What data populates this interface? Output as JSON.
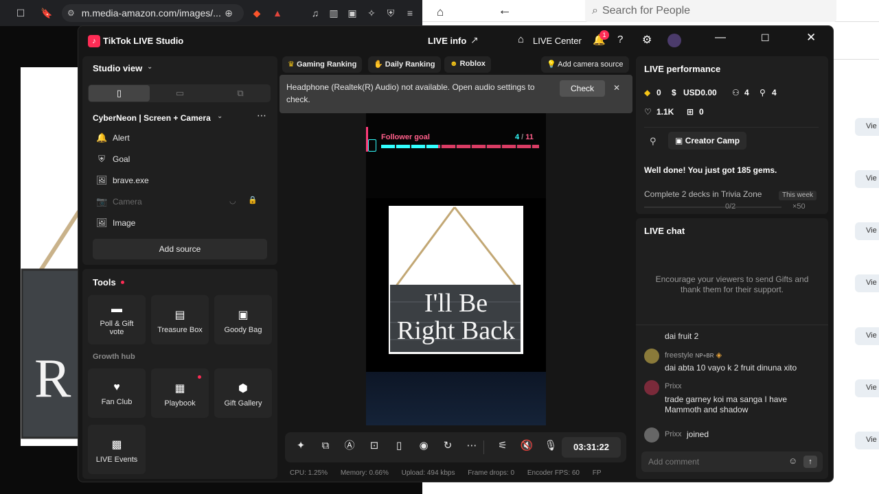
{
  "browser": {
    "url": "m.media-amazon.com/images/..."
  },
  "right_page": {
    "search_placeholder": "Search for People",
    "view_label": "Vie"
  },
  "app": {
    "title": "TikTok LIVE Studio",
    "live_info": "LIVE info",
    "live_center": "LIVE Center",
    "notification_count": "1"
  },
  "studio_view": {
    "title": "Studio view",
    "scene_name": "CyberNeon | Screen + Camera",
    "sources": [
      {
        "icon": "bell-icon",
        "label": "Alert",
        "disabled": false
      },
      {
        "icon": "shield-icon",
        "label": "Goal",
        "disabled": false
      },
      {
        "icon": "image-icon",
        "label": "brave.exe",
        "disabled": false
      },
      {
        "icon": "camera-icon",
        "label": "Camera",
        "disabled": true
      },
      {
        "icon": "image-icon",
        "label": "Image",
        "disabled": false
      }
    ],
    "add_source": "Add source"
  },
  "tools": {
    "title": "Tools",
    "items": [
      {
        "icon": "poll-icon",
        "label_1": "Poll & Gift",
        "label_2": "vote"
      },
      {
        "icon": "treasure-box-icon",
        "label_1": "Treasure Box",
        "label_2": ""
      },
      {
        "icon": "goody-bag-icon",
        "label_1": "Goody Bag",
        "label_2": ""
      }
    ],
    "growth_hub": "Growth hub",
    "growth_items": [
      {
        "icon": "heart-icon",
        "label": "Fan Club"
      },
      {
        "icon": "playbook-icon",
        "label": "Playbook"
      },
      {
        "icon": "gift-gallery-icon",
        "label": "Gift Gallery"
      },
      {
        "icon": "calendar-icon",
        "label": "LIVE Events"
      }
    ]
  },
  "top_chips": [
    "Gaming Ranking",
    "Daily Ranking",
    "Roblox"
  ],
  "add_camera_source": "Add camera source",
  "notice": {
    "text_1": "Headphone (Realtek(R) Audio) not available. Open audio settings to",
    "text_2": "check.",
    "check": "Check"
  },
  "preview": {
    "goal_label": "Follower goal",
    "goal_current": "4",
    "goal_sep": " / ",
    "goal_total": "11",
    "goal_progress": 0.36,
    "sign_line_1": "I'll Be",
    "sign_line_2": "Right Back"
  },
  "timer": "03:31:22",
  "status_bar": {
    "cpu": "CPU:  1.25%",
    "memory": "Memory:  0.66%",
    "upload": "Upload:  494 kbps",
    "frame_drops": "Frame drops:  0",
    "encoder_fps": "Encoder FPS:  60",
    "cut": "FP"
  },
  "performance": {
    "title": "LIVE performance",
    "diamonds": "0",
    "usd": "USD0.00",
    "viewers": "4",
    "new_followers": "4",
    "likes": "1.1K",
    "gifts": "0",
    "creator_camp": "Creator Camp",
    "well_done": "Well done! You just got 185 gems.",
    "task": "Complete 2 decks in Trivia Zone",
    "task_badge": "This week",
    "task_progress": "0/2",
    "task_reward": "×50"
  },
  "chat": {
    "title": "LIVE chat",
    "encourage_1": "Encourage your viewers to send Gifts and",
    "encourage_2": "thank them for their support.",
    "messages": [
      {
        "user": "",
        "badge": "",
        "text": "dai fruit 2"
      },
      {
        "user": "freestyle",
        "badge": "NP+BR",
        "text": "dai abta 10 vayo k 2 fruit dinuna xito"
      },
      {
        "user": "Prixx",
        "badge": "",
        "text_1": "trade garney koi ma sanga I have",
        "text_2": "Mammoth and shadow"
      },
      {
        "user": "Prixx",
        "badge": "",
        "text": "joined"
      }
    ],
    "placeholder": "Add comment"
  }
}
